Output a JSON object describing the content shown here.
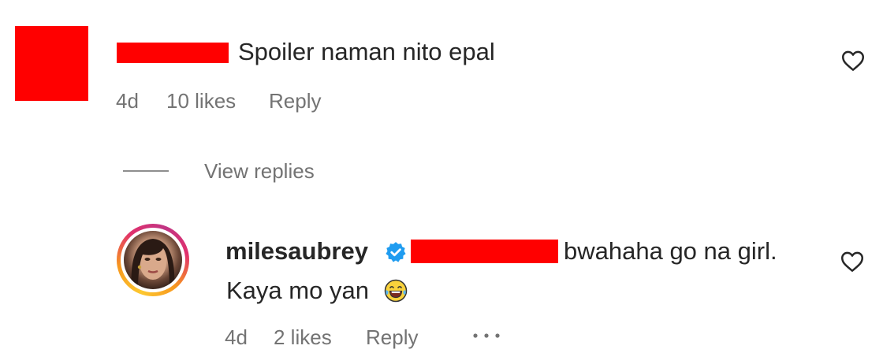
{
  "comments": [
    {
      "text": "Spoiler naman nito epal",
      "time": "4d",
      "likes": "10 likes",
      "reply_label": "Reply",
      "avatar_redacted": true,
      "username_redacted": true
    }
  ],
  "view_replies_label": "View replies",
  "reply": {
    "username": "milesaubrey",
    "verified": true,
    "mention_redacted": true,
    "text_line1": "bwahaha go na girl.",
    "text_line2": "Kaya mo yan",
    "emoji": "laughing-crying-emoji",
    "time": "4d",
    "likes": "2 likes",
    "reply_label": "Reply",
    "more_icon": "more-options-icon"
  },
  "icons": {
    "like": "heart-icon",
    "verified": "verified-badge-icon"
  },
  "colors": {
    "text": "#262626",
    "secondary": "#737373",
    "redaction": "#ff0000",
    "verified": "#1f9cf0"
  }
}
